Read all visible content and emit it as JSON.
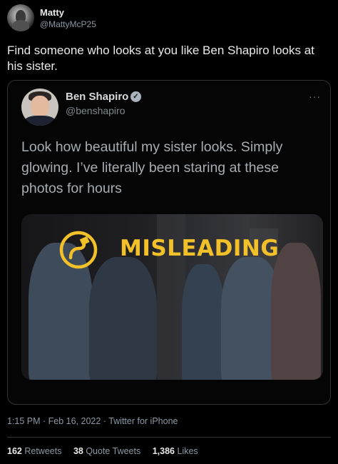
{
  "tweet": {
    "author_name": "Matty",
    "author_handle": "@MattyMcP25",
    "text": "Find someone who looks at you like Ben Shapiro looks at his sister.",
    "meta": "1:15 PM · Feb 16, 2022 · Twitter for iPhone"
  },
  "quoted": {
    "name": "Ben Shapiro",
    "handle": "@benshapiro",
    "verified_glyph": "✓",
    "more_glyph": "···",
    "text": "Look how beautiful my sister looks. Simply glowing. I’ve literally been staring at these photos for hours",
    "image_label": "MISLEADING"
  },
  "stats": {
    "retweets_count": "162",
    "retweets_label": "Retweets",
    "quotes_count": "38",
    "quotes_label": "Quote Tweets",
    "likes_count": "1,386",
    "likes_label": "Likes"
  },
  "colors": {
    "badge": "#f2c029",
    "background": "#000000",
    "border": "#2f3336"
  }
}
